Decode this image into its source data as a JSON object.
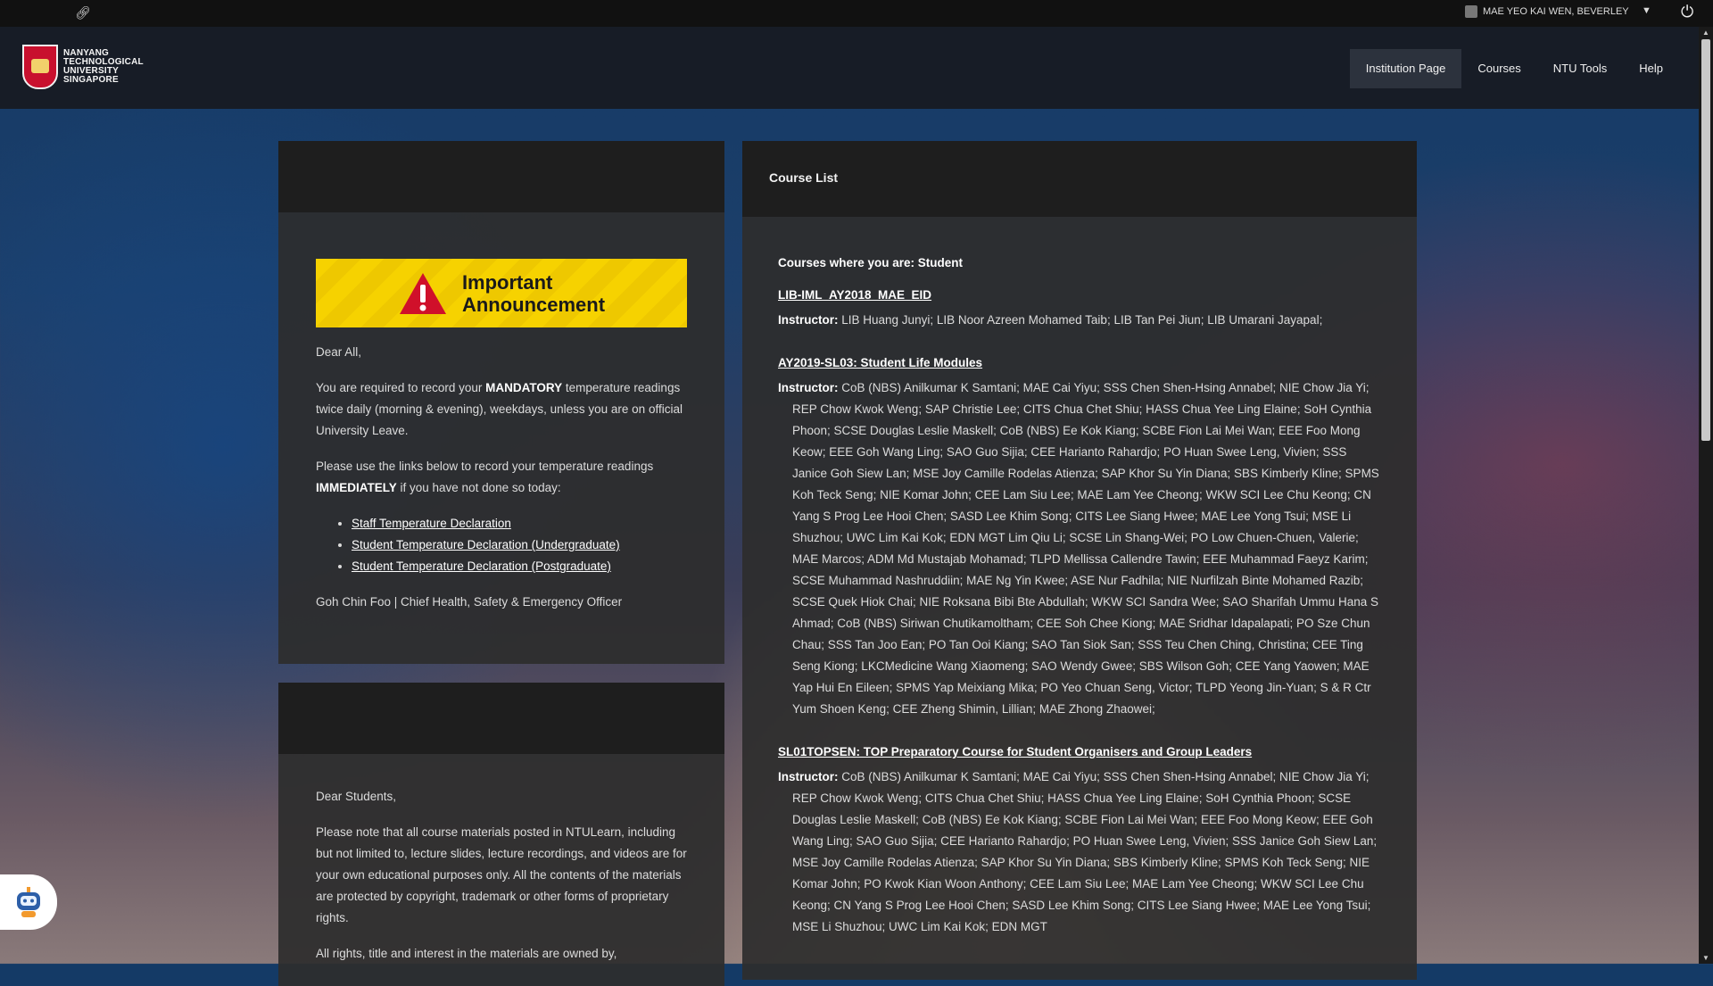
{
  "topbar": {
    "link_icon": "link-icon",
    "user_name": "MAE YEO KAI WEN, BEVERLEY",
    "caret": "▼",
    "power_icon": "⏻"
  },
  "header": {
    "logo_lines": [
      "NANYANG",
      "TECHNOLOGICAL",
      "UNIVERSITY",
      "SINGAPORE"
    ],
    "nav": [
      "Institution Page",
      "Courses",
      "NTU Tools",
      "Help"
    ]
  },
  "announcement": {
    "banner_line1": "Important",
    "banner_line2": "Announcement",
    "greeting": "Dear All,",
    "p1_a": "You are required to record your ",
    "p1_b": "MANDATORY",
    "p1_c": " temperature readings twice daily (morning & evening), weekdays, unless you are on official University Leave.",
    "p2_a": "Please use the links below to record your temperature readings ",
    "p2_b": "IMMEDIATELY",
    "p2_c": " if you have not done so today:",
    "links": [
      "Staff Temperature Declaration",
      "Student Temperature Declaration (Undergraduate)",
      "Student Temperature Declaration (Postgraduate)"
    ],
    "signature": "Goh Chin Foo | Chief Health, Safety & Emergency Officer"
  },
  "notice": {
    "greeting": "Dear Students,",
    "p1": "Please note that all course materials posted in NTULearn, including but not limited to, lecture slides, lecture recordings, and videos are for your own educational purposes only. All the contents of the materials are protected by copyright, trademark or other forms of proprietary rights.",
    "p2": "All rights, title and interest in the materials are owned by,"
  },
  "course_list": {
    "title": "Course List",
    "role": "Courses where you are: Student",
    "instructor_label": "Instructor:",
    "courses": [
      {
        "name": "LIB-IML_AY2018_MAE_EID",
        "instructors": "LIB Huang Junyi;  LIB Noor Azreen Mohamed Taib;  LIB Tan Pei Jiun;  LIB Umarani Jayapal;"
      },
      {
        "name": "AY2019-SL03: Student Life Modules",
        "instructors": "CoB (NBS) Anilkumar K Samtani;  MAE Cai Yiyu;  SSS Chen Shen-Hsing Annabel;  NIE Chow Jia Yi;  REP Chow Kwok Weng;  SAP Christie Lee;  CITS Chua Chet Shiu;  HASS Chua Yee Ling Elaine;  SoH Cynthia Phoon;  SCSE Douglas Leslie Maskell;  CoB (NBS) Ee Kok Kiang;  SCBE Fion Lai Mei Wan;  EEE Foo Mong Keow;  EEE Goh Wang Ling;  SAO Guo Sijia;  CEE Harianto Rahardjo;  PO Huan Swee Leng, Vivien;  SSS Janice Goh Siew Lan;  MSE Joy Camille Rodelas Atienza;  SAP Khor Su Yin Diana;  SBS Kimberly Kline;  SPMS Koh Teck Seng;  NIE Komar John;  CEE Lam Siu Lee;  MAE Lam Yee Cheong;  WKW SCI Lee Chu Keong;  CN Yang S Prog Lee Hooi Chen;  SASD Lee Khim Song;  CITS Lee Siang Hwee;  MAE Lee Yong Tsui;  MSE Li Shuzhou;  UWC Lim Kai Kok;  EDN MGT Lim Qiu Li;  SCSE Lin Shang-Wei;  PO Low Chuen-Chuen, Valerie;  MAE Marcos;  ADM Md Mustajab Mohamad;  TLPD Mellissa Callendre Tawin;  EEE Muhammad Faeyz Karim;  SCSE Muhammad Nashruddiin;  MAE Ng Yin Kwee;  ASE Nur Fadhila;  NIE Nurfilzah Binte Mohamed Razib;  SCSE Quek Hiok Chai;  NIE Roksana Bibi Bte Abdullah;  WKW SCI Sandra Wee;  SAO Sharifah Ummu Hana S Ahmad;  CoB (NBS) Siriwan Chutikamoltham;  CEE Soh Chee Kiong;  MAE Sridhar Idapalapati;  PO Sze Chun Chau;  SSS Tan Joo Ean;  PO Tan Ooi Kiang;  SAO Tan Siok San;  SSS Teu Chen Ching, Christina;  CEE Ting Seng Kiong;  LKCMedicine Wang Xiaomeng;  SAO Wendy Gwee;  SBS Wilson Goh;  CEE Yang Yaowen;  MAE Yap Hui En Eileen;  SPMS Yap Meixiang Mika;  PO Yeo Chuan Seng, Victor;  TLPD Yeong Jin-Yuan;  S & R Ctr Yum Shoen Keng;  CEE Zheng Shimin, Lillian;  MAE Zhong Zhaowei;"
      },
      {
        "name": "SL01TOPSEN: TOP Preparatory Course for Student Organisers and Group Leaders",
        "instructors": "CoB (NBS) Anilkumar K Samtani;  MAE Cai Yiyu;  SSS Chen Shen-Hsing Annabel;  NIE Chow Jia Yi;  REP Chow Kwok Weng;  CITS Chua Chet Shiu;  HASS Chua Yee Ling Elaine;  SoH Cynthia Phoon;  SCSE Douglas Leslie Maskell;  CoB (NBS) Ee Kok Kiang;  SCBE Fion Lai Mei Wan;  EEE Foo Mong Keow;  EEE Goh Wang Ling;  SAO Guo Sijia;  CEE Harianto Rahardjo;  PO Huan Swee Leng, Vivien;  SSS Janice Goh Siew Lan;  MSE Joy Camille Rodelas Atienza;  SAP Khor Su Yin Diana;  SBS Kimberly Kline;  SPMS Koh Teck Seng;  NIE Komar John;  PO Kwok Kian Woon Anthony;  CEE Lam Siu Lee;  MAE Lam Yee Cheong;  WKW SCI Lee Chu Keong;  CN Yang S Prog Lee Hooi Chen;  SASD Lee Khim Song;  CITS Lee Siang Hwee;  MAE Lee Yong Tsui;  MSE Li Shuzhou;  UWC Lim Kai Kok;  EDN MGT"
      }
    ]
  }
}
